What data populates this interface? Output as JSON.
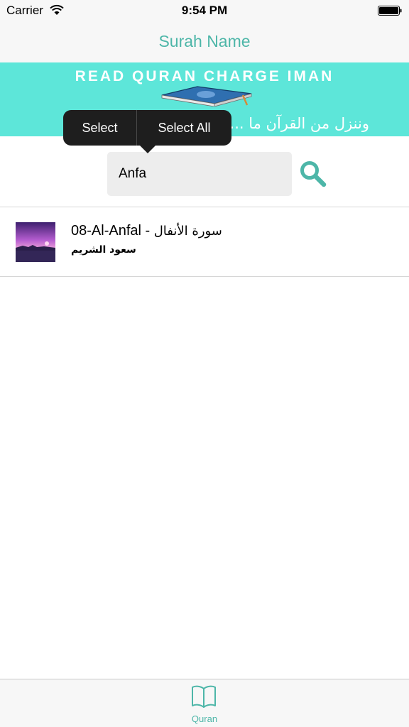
{
  "status_bar": {
    "carrier": "Carrier",
    "time": "9:54 PM"
  },
  "nav": {
    "title": "Surah Name"
  },
  "banner": {
    "title": "READ QURAN CHARGE IMAN",
    "arabic": "وننزل من القرآن ما ... ــتين"
  },
  "context_menu": {
    "select": "Select",
    "select_all": "Select All"
  },
  "search": {
    "value": "Anfa",
    "placeholder": ""
  },
  "results": [
    {
      "title": "08-Al-Anfal -",
      "title_ar": "سورة الأنفال",
      "reciter": "سعود الشريم"
    }
  ],
  "tabs": [
    {
      "label": "Quran",
      "icon": "open-book-icon"
    }
  ],
  "colors": {
    "accent": "#4db6a8",
    "banner": "#5de6d9"
  }
}
